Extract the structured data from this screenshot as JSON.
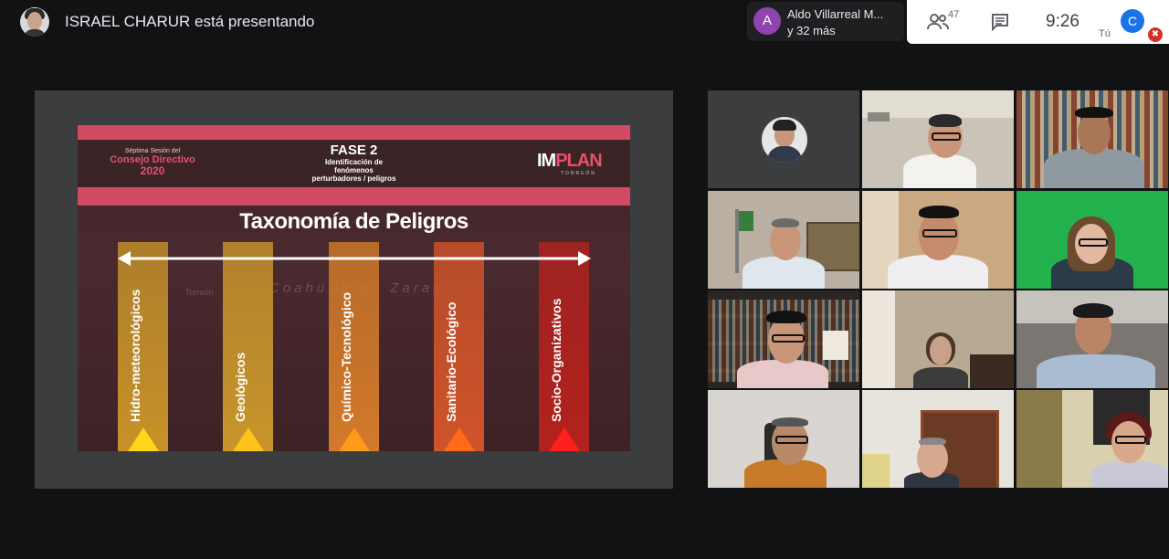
{
  "header": {
    "presenter_text": "ISRAEL CHARUR está presentando",
    "speaker_name": "Aldo Villarreal M...",
    "speaker_more": "y 32 más",
    "speaker_initial": "A",
    "participants_count": "47",
    "clock": "9:26",
    "self_initial": "C",
    "self_label": "Tú"
  },
  "slide": {
    "session_line1": "Séptima Sesión del",
    "session_line2": "Consejo Directivo",
    "session_year": "2020",
    "phase_title": "FASE 2",
    "phase_sub1": "Identificación de",
    "phase_sub2": "fenómenos",
    "phase_sub3": "perturbadores / peligros",
    "logo_im": "IM",
    "logo_plan": "PLAN",
    "logo_sub": "TORREÓN",
    "title": "Taxonomía de Peligros",
    "watermark": "Coahuila de Zaragoza",
    "watermark_city": "Torreón",
    "categories": [
      {
        "label": "Hidro-meteorológicos",
        "color": "#c7922a",
        "tri": "#ffd61a"
      },
      {
        "label": "Geológicos",
        "color": "#c9962c",
        "tri": "#ffc21a"
      },
      {
        "label": "Químico-Tecnológico",
        "color": "#d27a2a",
        "tri": "#ff9a1a"
      },
      {
        "label": "Sanitario-Ecológico",
        "color": "#d0542a",
        "tri": "#ff6a1a"
      },
      {
        "label": "Socio-Organizativos",
        "color": "#b3221e",
        "tri": "#ff1f1f"
      }
    ]
  }
}
